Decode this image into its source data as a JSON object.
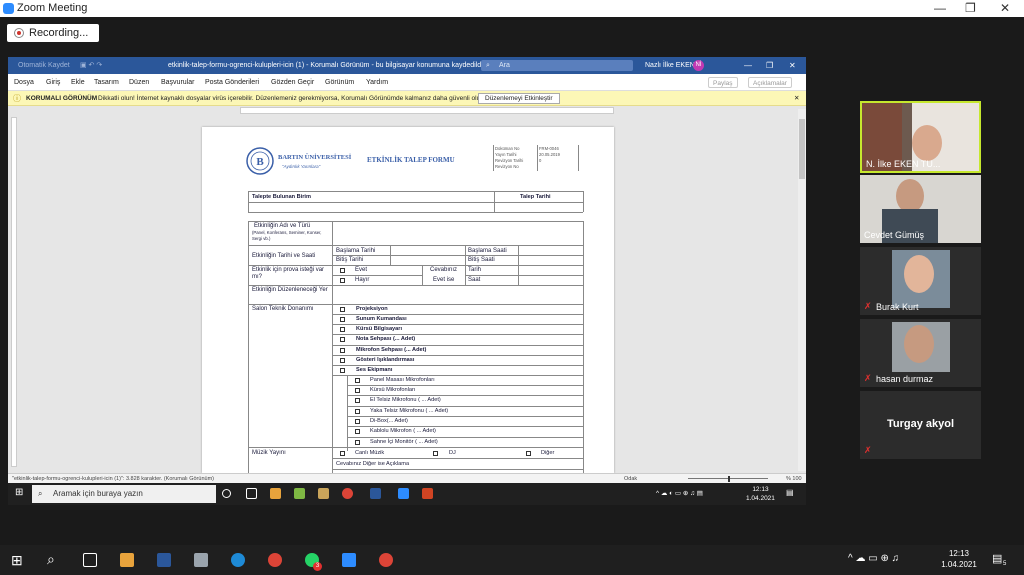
{
  "zoom": {
    "title": "Zoom Meeting",
    "recording": "Recording...",
    "window_controls": {
      "minimize": "—",
      "restore": "❐",
      "close": "✕"
    }
  },
  "word": {
    "qat": "Otomatik Kaydet",
    "title": "etkinlik-talep-formu-ogrenci-kulupleri-icin (1) - Korumalı Görünüm - bu bilgisayar konumuna kaydedildi",
    "search": "Ara",
    "user": "Nazlı İlke EKEN",
    "user_initials": "Nİ",
    "menu": [
      "Dosya",
      "Giriş",
      "Ekle",
      "Tasarım",
      "Düzen",
      "Başvurular",
      "Posta Gönderileri",
      "Gözden Geçir",
      "Görünüm",
      "Yardım"
    ],
    "share": "Paylaş",
    "comments": "Açıklamalar",
    "protected_label": "KORUMALI GÖRÜNÜM",
    "protected_msg": "Dikkatli olun! İnternet kaynaklı dosyalar virüs içerebilir. Düzenlemeniz gerekmiyorsa, Korumalı Görünümde kalmanız daha güvenli olur.",
    "enable_edit": "Düzenlemeyi Etkinleştir",
    "status_left": "\"etkinlik-talep-formu-ogrenci-kulupleri-icin (1)\": 3.828 karakter. (Korumalı Görünüm)",
    "status_focus": "Odak",
    "zoom_pct": "% 100"
  },
  "doc": {
    "university": "BARTIN ÜNİVERSİTESİ",
    "motto": "\"Aydınlık Yarınlara\"",
    "form_title": "ETKİNLİK TALEP FORMU",
    "meta": [
      {
        "k": "Doküman No",
        "v": "FRM-0046"
      },
      {
        "k": "Yayın Tarihi",
        "v": "20.05.2019"
      },
      {
        "k": "Revizyon Tarihi",
        "v": ""
      },
      {
        "k": "Revizyon No",
        "v": "0"
      }
    ],
    "unit_label": "Talepte Bulunan Birim",
    "request_date": "Talep Tarihi",
    "event_name": "Etkinliğin Adı ve Türü",
    "event_name_sub": "(Panel, Konferans, Seminer, Konser, Sergi vb.)",
    "date_time": "Etkinliğin Tarihi ve Saati",
    "start_date": "Başlama Tarihi",
    "end_date": "Bitiş Tarihi",
    "start_time": "Başlama Saati",
    "end_time": "Bitiş Saati",
    "rehearsal_q": "Etkinlik için prova isteği var mı?",
    "yes": "Evet",
    "no": "Hayır",
    "answer": "Cevabınız",
    "if_yes": "Evet ise",
    "date_lbl": "Tarih",
    "time_lbl": "Saat",
    "place": "Etkinliğin Düzenleneceği Yer",
    "tech": "Salon Teknik Donanımı",
    "tech_items": [
      "Projeksiyon",
      "Sunum Kumandası",
      "Kürsü Bilgisayarı",
      "Nota Sehpası (... Adet)",
      "Mikrofon Sehpası (... Adet)",
      "Gösteri Işıklandırması",
      "Ses Ekipmanı"
    ],
    "sound_items": [
      "Panel Masası Mikrofonları",
      "Kürsü Mikrofonları",
      "El Telsiz Mikrofonu ( ... Adet)",
      "Yaka Telsiz Mikrofonu ( ... Adet)",
      "Di-Box(... Adet)",
      "Kablolu Mikrofon ( ... Adet)",
      "Sahne İçi Monitör ( ... Adet)"
    ],
    "music": "Müzik Yayını",
    "music_opts": [
      "Canlı Müzik",
      "DJ",
      "Diğer"
    ],
    "music_other": "Cevabınız Diğer ise Açıklama"
  },
  "inner_taskbar": {
    "search": "Aramak için buraya yazın",
    "time": "12:13",
    "date": "1.04.2021"
  },
  "participants": [
    {
      "name": "N. İlke EKEN TU...",
      "muted": false
    },
    {
      "name": "Cevdet Gümüş",
      "muted": false
    },
    {
      "name": "Burak Kurt",
      "muted": true
    },
    {
      "name": "hasan durmaz",
      "muted": true
    },
    {
      "name": "Turgay akyol",
      "muted": true
    }
  ],
  "taskbar": {
    "time": "12:13",
    "date": "1.04.2021",
    "badge": "3",
    "notif": "5"
  },
  "colors": {
    "word_blue": "#2b579a",
    "zoom_blue": "#2d8cff",
    "active_speaker": "#c6e82e",
    "muted_red": "#e0302f"
  }
}
